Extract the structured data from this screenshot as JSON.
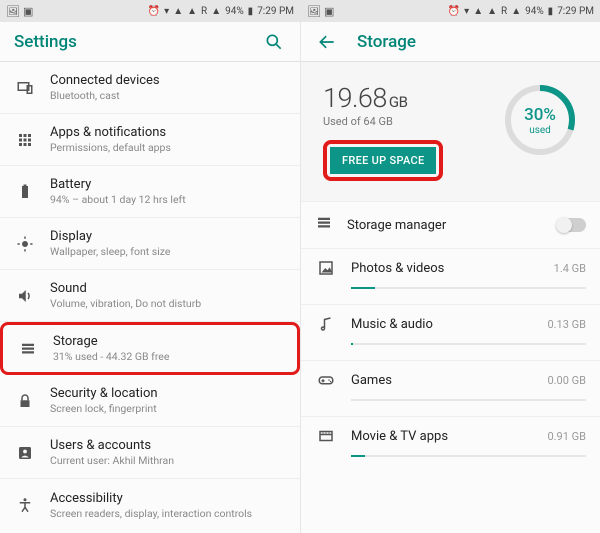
{
  "status": {
    "time": "7:29 PM",
    "battery_pct": "94%",
    "net_label": "R"
  },
  "left": {
    "title": "Settings",
    "items": [
      {
        "label": "Connected devices",
        "sub": "Bluetooth, cast"
      },
      {
        "label": "Apps & notifications",
        "sub": "Permissions, default apps"
      },
      {
        "label": "Battery",
        "sub": "94% – about 1 day 12 hrs left"
      },
      {
        "label": "Display",
        "sub": "Wallpaper, sleep, font size"
      },
      {
        "label": "Sound",
        "sub": "Volume, vibration, Do not disturb"
      },
      {
        "label": "Storage",
        "sub": "31% used - 44.32 GB free"
      },
      {
        "label": "Security & location",
        "sub": "Screen lock, fingerprint"
      },
      {
        "label": "Users & accounts",
        "sub": "Current user: Akhil Mithran"
      },
      {
        "label": "Accessibility",
        "sub": "Screen readers, display, interaction controls"
      }
    ]
  },
  "right": {
    "title": "Storage",
    "used_value": "19.68",
    "used_unit": "GB",
    "total_label": "Used of 64 GB",
    "free_btn": "FREE UP SPACE",
    "ring_pct": "30%",
    "ring_label": "used",
    "manager_label": "Storage manager",
    "categories": [
      {
        "label": "Photos & videos",
        "size": "1.4 GB",
        "fill_pct": 10
      },
      {
        "label": "Music & audio",
        "size": "0.13 GB",
        "fill_pct": 1
      },
      {
        "label": "Games",
        "size": "0.00 GB",
        "fill_pct": 0
      },
      {
        "label": "Movie & TV apps",
        "size": "0.91 GB",
        "fill_pct": 6
      }
    ]
  }
}
